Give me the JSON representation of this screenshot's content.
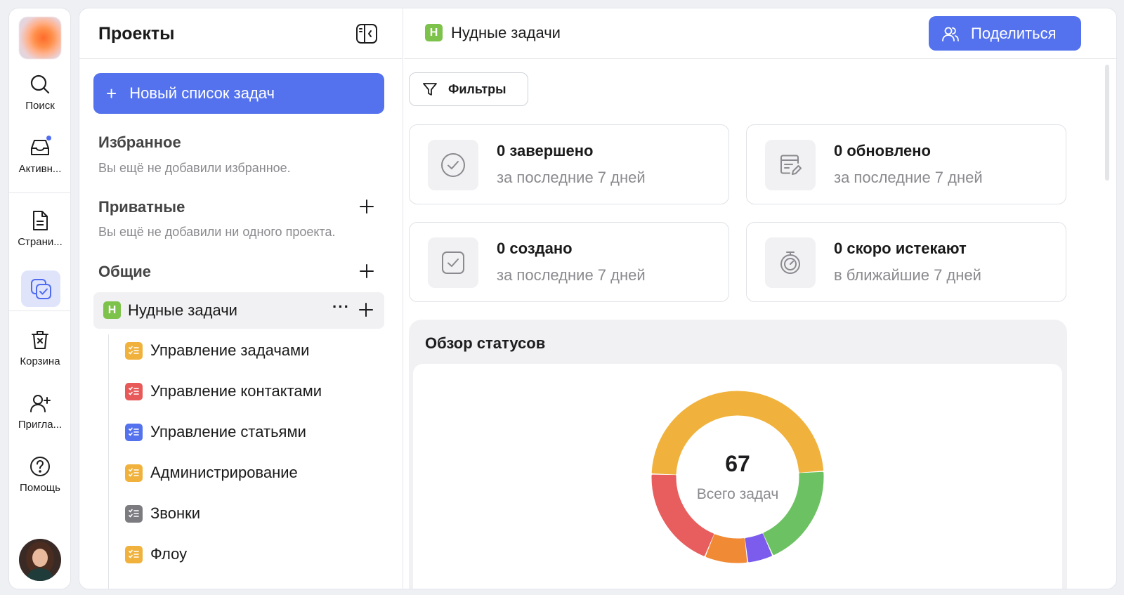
{
  "rail": {
    "items": [
      {
        "label": "Поиск",
        "icon": "search-icon"
      },
      {
        "label": "Активн...",
        "icon": "inbox-icon"
      },
      {
        "label": "Страни...",
        "icon": "page-icon"
      },
      {
        "label": "",
        "icon": "tasks-icon"
      },
      {
        "label": "Корзина",
        "icon": "trash-icon"
      },
      {
        "label": "Пригла...",
        "icon": "invite-icon"
      },
      {
        "label": "Помощь",
        "icon": "help-icon"
      }
    ]
  },
  "projects": {
    "title": "Проекты",
    "new_list_label": "Новый список задач",
    "favorites": {
      "title": "Избранное",
      "empty": "Вы ещё не добавили избранное."
    },
    "private": {
      "title": "Приватные",
      "empty": "Вы ещё не добавили ни одного проекта."
    },
    "shared": {
      "title": "Общие"
    },
    "active_project": {
      "badge": "Н",
      "name": "Нудные задачи",
      "more": "···"
    },
    "lists": [
      {
        "name": "Управление задачами",
        "color": "#f0b23c"
      },
      {
        "name": "Управление контактами",
        "color": "#e85a5a"
      },
      {
        "name": "Управление статьями",
        "color": "#5472ee"
      },
      {
        "name": "Администрирование",
        "color": "#f0b23c"
      },
      {
        "name": "Звонки",
        "color": "#7c7c80"
      },
      {
        "name": "Флоу",
        "color": "#f0b23c"
      }
    ]
  },
  "header": {
    "badge": "Н",
    "title": "Нудные задачи",
    "share_label": "Поделиться"
  },
  "filters_label": "Фильтры",
  "stats": [
    {
      "title": "0 завершено",
      "sub": "за последние 7 дней",
      "icon": "check-circle-icon"
    },
    {
      "title": "0 обновлено",
      "sub": "за последние 7 дней",
      "icon": "calendar-edit-icon"
    },
    {
      "title": "0 создано",
      "sub": "за последние 7 дней",
      "icon": "check-square-icon"
    },
    {
      "title": "0 скоро истекают",
      "sub": "в ближайшие 7 дней",
      "icon": "timer-icon"
    }
  ],
  "overview": {
    "title": "Обзор статусов",
    "total": "67",
    "total_label": "Всего задач"
  },
  "colors": {
    "accent": "#5472ee",
    "badge_green": "#7dc24b"
  },
  "chart_data": {
    "type": "pie",
    "title": "Обзор статусов",
    "total": 67,
    "series": [
      {
        "color": "#f0b23c",
        "value": 30
      },
      {
        "color": "#6cc262",
        "value": 12
      },
      {
        "color": "#7b5cec",
        "value": 3
      },
      {
        "color": "#f08a34",
        "value": 5
      },
      {
        "color": "#e85d5d",
        "value": 12
      }
    ]
  }
}
